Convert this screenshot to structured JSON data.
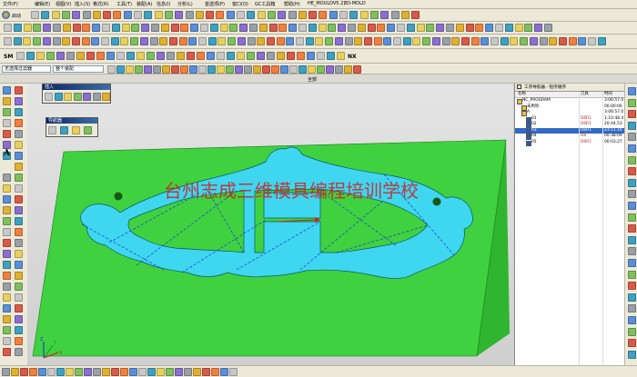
{
  "menu": {
    "items": [
      "文件(F)",
      "编辑(E)",
      "视图(V)",
      "插入(S)",
      "格式(R)",
      "工具(T)",
      "装配(A)",
      "信息(I)",
      "分析(L)",
      "首选项(P)",
      "窗口(O)",
      "GC工具箱",
      "帮助(H)",
      "HE_MOULDV5.2)",
      "3D-MOLD"
    ]
  },
  "toolbar": {
    "start_label": "启动",
    "sm_label": "SM",
    "nx_label": "NX"
  },
  "filters": {
    "selection_filter": "无选择过滤器",
    "assembly_scope": "整个装配"
  },
  "viewport": {
    "title": "全部",
    "watermark": "台州志成三维模具编程培训学校",
    "model_color": "#3fd13f",
    "cavity_color": "#3fd6f0"
  },
  "floats": {
    "insert_title": "插入",
    "nav_title": "导航器"
  },
  "navigator": {
    "title": "工序导航器 - 程序顺序",
    "columns": [
      "名称",
      "刀具",
      "时间"
    ],
    "rows": [
      {
        "name": "NC_PROGRAM",
        "tool": "",
        "time": "3:06:57.0",
        "indent": 0,
        "selected": false
      },
      {
        "name": "未用项",
        "tool": "",
        "time": "00:00:00",
        "indent": 1,
        "selected": false
      },
      {
        "name": "A",
        "tool": "",
        "time": "3:06:57.0",
        "indent": 1,
        "selected": false
      },
      {
        "name": "01",
        "tool": "D6R1",
        "time": "1:10:48.4",
        "indent": 2,
        "selected": false
      },
      {
        "name": "02",
        "tool": "D6R1",
        "time": "20:44.53",
        "indent": 2,
        "selected": false
      },
      {
        "name": "03",
        "tool": "D6R1",
        "time": "23:11.16",
        "indent": 2,
        "selected": true
      },
      {
        "name": "04",
        "tool": "D8",
        "time": "00:38:09",
        "indent": 2,
        "selected": false
      },
      {
        "name": "05",
        "tool": "D6R1",
        "time": "00:03:27",
        "indent": 2,
        "selected": false
      }
    ]
  },
  "axis": {
    "z": "Z",
    "y": "Y",
    "x": "X"
  }
}
